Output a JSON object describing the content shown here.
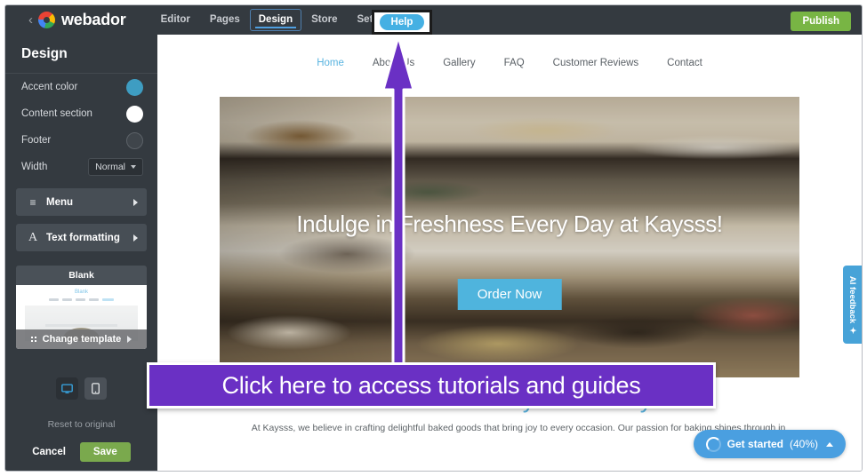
{
  "topbar": {
    "back_icon": "chevron-left-icon",
    "brand": "webador",
    "nav": [
      {
        "label": "Editor",
        "active": false
      },
      {
        "label": "Pages",
        "active": false
      },
      {
        "label": "Design",
        "active": true
      },
      {
        "label": "Store",
        "active": false
      },
      {
        "label": "Settings",
        "active": false
      }
    ],
    "help_label": "Help",
    "publish_label": "Publish"
  },
  "sidebar": {
    "title": "Design",
    "options": [
      {
        "label": "Accent color",
        "control": "color-swatch",
        "value": "#3e9dc2"
      },
      {
        "label": "Content section",
        "control": "color-swatch",
        "value": "#ffffff"
      },
      {
        "label": "Footer",
        "control": "color-swatch",
        "value": "#3f454b"
      }
    ],
    "width": {
      "label": "Width",
      "value": "Normal"
    },
    "panels": [
      {
        "label": "Menu",
        "icon": "hamburger-icon",
        "glyph": "≡"
      },
      {
        "label": "Text formatting",
        "icon": "text-format-icon",
        "glyph": "A"
      }
    ],
    "template": {
      "name": "Blank",
      "preview_title": "Blank",
      "change_label": "Change template"
    },
    "devices": [
      {
        "name": "desktop",
        "active": true
      },
      {
        "name": "mobile",
        "active": false
      }
    ],
    "reset_label": "Reset to original",
    "cancel_label": "Cancel",
    "save_label": "Save"
  },
  "site": {
    "nav": [
      {
        "label": "Home",
        "current": true
      },
      {
        "label": "About Us",
        "current": false
      },
      {
        "label": "Gallery",
        "current": false
      },
      {
        "label": "FAQ",
        "current": false
      },
      {
        "label": "Customer Reviews",
        "current": false
      },
      {
        "label": "Contact",
        "current": false
      }
    ],
    "hero_title": "Indulge in Freshness Every Day at Kaysss!",
    "hero_cta": "Order Now",
    "welcome_title": "Welcome to Kaysss Bakery!",
    "welcome_body": "At Kaysss, we believe in crafting delightful baked goods that bring joy to every occasion. Our passion for baking shines through in"
  },
  "ai_feedback": {
    "label": "AI feedback",
    "icon": "sparkle-icon",
    "glyph": "✦"
  },
  "get_started": {
    "label": "Get started",
    "percent": "(40%)",
    "icon": "progress-spinner-icon",
    "chevron": "chevron-up-icon"
  },
  "annotation": {
    "banner_text": "Click here to access tutorials and guides",
    "arrow": "up-arrow-pointer",
    "color": "#6a30c4"
  },
  "colors": {
    "accent": "#3e9dc2",
    "chrome": "#343a40",
    "publish_green": "#78b544",
    "help_blue": "#45b0e3",
    "annotation_purple": "#6a30c4",
    "site_blue": "#5ab4e0"
  }
}
